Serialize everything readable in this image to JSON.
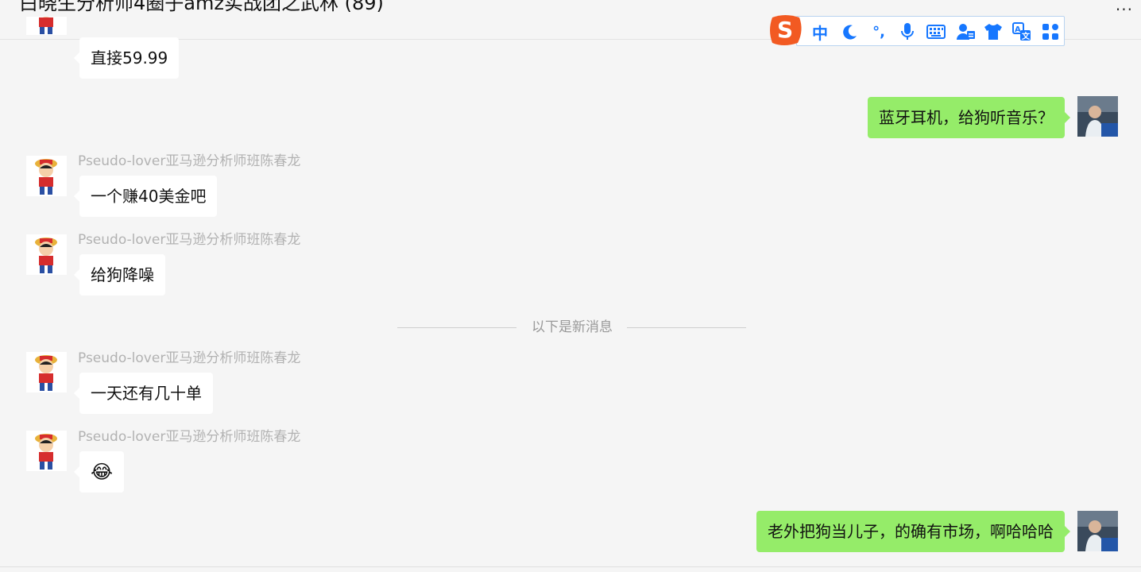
{
  "window": {
    "title": "白晓生分析师4圈子amz实战团之武林 (89)",
    "more_label": "···"
  },
  "ime_toolbar": {
    "logo_letter": "S",
    "items": [
      {
        "icon": "chinese-mode-icon",
        "label": "中"
      },
      {
        "icon": "moon-icon",
        "label": "☾"
      },
      {
        "icon": "punctuation-icon",
        "label": "°,"
      },
      {
        "icon": "microphone-icon",
        "label": "🎤"
      },
      {
        "icon": "keyboard-icon",
        "label": "⌨"
      },
      {
        "icon": "account-icon",
        "label": "👤"
      },
      {
        "icon": "skin-shirt-icon",
        "label": "👕"
      },
      {
        "icon": "translate-icon",
        "label": "文"
      },
      {
        "icon": "toolbox-icon",
        "label": "▦"
      }
    ]
  },
  "messages": [
    {
      "side": "in",
      "text": "直接59.99"
    },
    {
      "side": "out",
      "text": "蓝牙耳机，给狗听音乐？"
    },
    {
      "side": "in",
      "sender": "Pseudo-lover亚马逊分析师班陈春龙",
      "text": "一个赚40美金吧"
    },
    {
      "side": "in",
      "sender": "Pseudo-lover亚马逊分析师班陈春龙",
      "text": "给狗降噪"
    },
    {
      "side": "in",
      "sender": "Pseudo-lover亚马逊分析师班陈春龙",
      "text": "一天还有几十单"
    },
    {
      "side": "in",
      "sender": "Pseudo-lover亚马逊分析师班陈春龙",
      "text": "😂"
    },
    {
      "side": "out",
      "text": "老外把狗当儿子，的确有市场，啊哈哈哈"
    }
  ],
  "divider_text": "以下是新消息",
  "colors": {
    "bubble_out": "#95ec69",
    "bubble_in": "#ffffff",
    "background": "#f5f5f5"
  }
}
